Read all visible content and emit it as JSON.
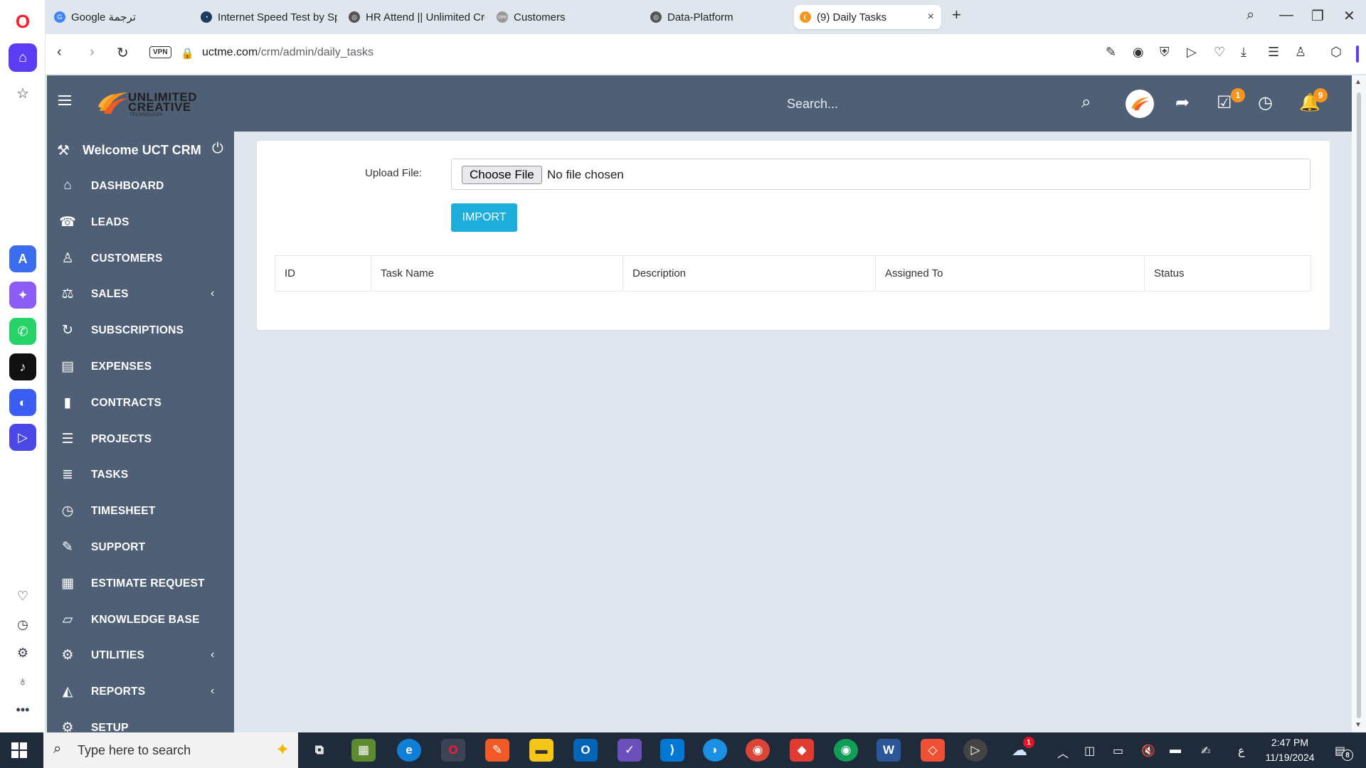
{
  "browser": {
    "tabs": [
      {
        "label": "Google ترجمة",
        "icon": "google-translate-icon"
      },
      {
        "label": "Internet Speed Test by Sp",
        "icon": "speedtest-icon"
      },
      {
        "label": "HR Attend || Unlimited Cre",
        "icon": "globe-icon"
      },
      {
        "label": "Customers",
        "icon": "crm-icon"
      },
      {
        "label": "Data-Platform",
        "icon": "globe-icon"
      },
      {
        "label": "(9) Daily Tasks",
        "icon": "uct-icon",
        "active": true
      }
    ],
    "url_host": "uctme.com",
    "url_path": "/crm/admin/daily_tasks",
    "vpn_label": "VPN"
  },
  "header": {
    "brand_line1": "UNLIMITED",
    "brand_line2": "CREATIVE",
    "brand_line3": "TECHNOLOGY",
    "search_placeholder": "Search...",
    "tasks_badge": "1",
    "notifications_badge": "9"
  },
  "sidebar": {
    "welcome": "Welcome UCT CRM",
    "items": [
      {
        "label": "DASHBOARD",
        "icon": "home-icon",
        "glyph": "⌂"
      },
      {
        "label": "LEADS",
        "icon": "phone-icon",
        "glyph": "☎"
      },
      {
        "label": "CUSTOMERS",
        "icon": "user-icon",
        "glyph": "♙"
      },
      {
        "label": "SALES",
        "icon": "balance-scale-icon",
        "glyph": "⚖",
        "chevron": true
      },
      {
        "label": "SUBSCRIPTIONS",
        "icon": "refresh-icon",
        "glyph": "↻"
      },
      {
        "label": "EXPENSES",
        "icon": "file-text-icon",
        "glyph": "▤"
      },
      {
        "label": "CONTRACTS",
        "icon": "file-icon",
        "glyph": "▮"
      },
      {
        "label": "PROJECTS",
        "icon": "bars-icon",
        "glyph": "☰"
      },
      {
        "label": "TASKS",
        "icon": "tasks-icon",
        "glyph": "≣"
      },
      {
        "label": "TIMESHEET",
        "icon": "clock-icon",
        "glyph": "◷"
      },
      {
        "label": "SUPPORT",
        "icon": "ticket-icon",
        "glyph": "✎"
      },
      {
        "label": "ESTIMATE REQUEST",
        "icon": "list-alt-icon",
        "glyph": "▦"
      },
      {
        "label": "KNOWLEDGE BASE",
        "icon": "folder-open-icon",
        "glyph": "▱"
      },
      {
        "label": "UTILITIES",
        "icon": "cogs-icon",
        "glyph": "⚙",
        "chevron": true
      },
      {
        "label": "REPORTS",
        "icon": "area-chart-icon",
        "glyph": "◭",
        "chevron": true
      },
      {
        "label": "SETUP",
        "icon": "gear-icon",
        "glyph": "⚙"
      }
    ]
  },
  "main": {
    "upload_label": "Upload File:",
    "choose_file_label": "Choose File",
    "no_file_label": "No file chosen",
    "import_label": "IMPORT",
    "table_headers": [
      "ID",
      "Task Name",
      "Description",
      "Assigned To",
      "Status"
    ]
  },
  "taskbar": {
    "search_placeholder": "Type here to search",
    "time": "2:47 PM",
    "date": "11/19/2024",
    "lang": "ع",
    "onedrive_badge": "1",
    "notif_count": "8"
  },
  "colors": {
    "header_bg": "#4f5f76",
    "accent": "#1eaedb",
    "badge": "#f7941d"
  }
}
